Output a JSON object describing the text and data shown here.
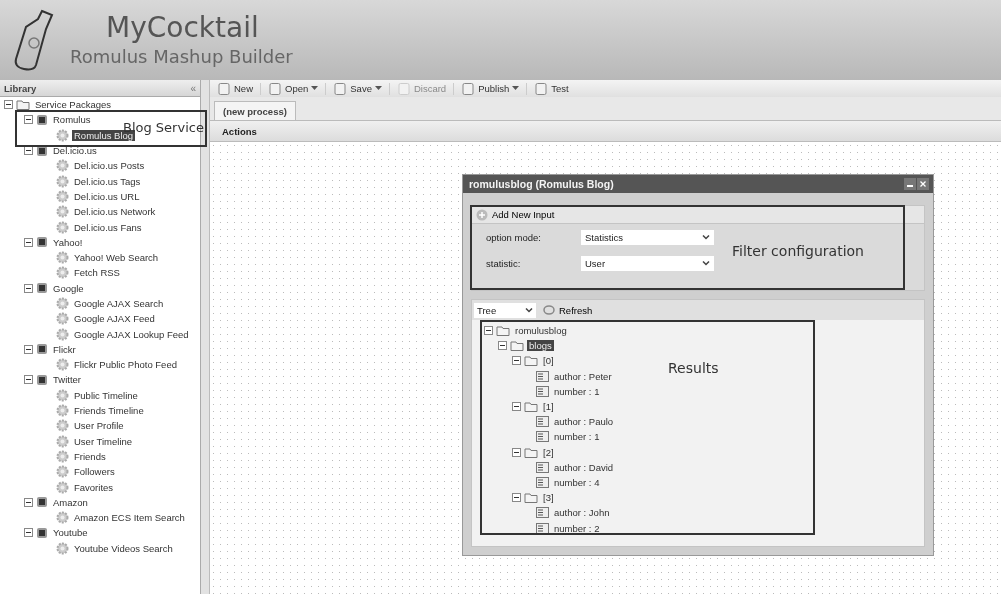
{
  "app": {
    "title": "MyCocktail",
    "subtitle": "Romulus Mashup Builder"
  },
  "library": {
    "title": "Library",
    "collapse": "«",
    "items": [
      {
        "label": "Service Packages",
        "expanded": true,
        "selected": false,
        "children": [
          {
            "label": "Romulus",
            "expanded": true,
            "selected": false,
            "children": [
              {
                "label": "Romulus Blog",
                "selected": true
              }
            ]
          },
          {
            "label": "Del.icio.us",
            "expanded": true,
            "selected": false,
            "children": [
              {
                "label": "Del.icio.us Posts",
                "selected": false
              },
              {
                "label": "Del.icio.us Tags",
                "selected": false
              },
              {
                "label": "Del.icio.us URL",
                "selected": false
              },
              {
                "label": "Del.icio.us Network",
                "selected": false
              },
              {
                "label": "Del.icio.us Fans",
                "selected": false
              }
            ]
          },
          {
            "label": "Yahoo!",
            "expanded": true,
            "selected": false,
            "children": [
              {
                "label": "Yahoo! Web Search",
                "selected": false
              },
              {
                "label": "Fetch RSS",
                "selected": false
              }
            ]
          },
          {
            "label": "Google",
            "expanded": true,
            "selected": false,
            "children": [
              {
                "label": "Google AJAX Search",
                "selected": false
              },
              {
                "label": "Google AJAX Feed",
                "selected": false
              },
              {
                "label": "Google AJAX Lookup Feed",
                "selected": false
              }
            ]
          },
          {
            "label": "Flickr",
            "expanded": true,
            "selected": false,
            "children": [
              {
                "label": "Flickr Public Photo Feed",
                "selected": false
              }
            ]
          },
          {
            "label": "Twitter",
            "expanded": true,
            "selected": false,
            "children": [
              {
                "label": "Public Timeline",
                "selected": false
              },
              {
                "label": "Friends Timeline",
                "selected": false
              },
              {
                "label": "User Profile",
                "selected": false
              },
              {
                "label": "User Timeline",
                "selected": false
              },
              {
                "label": "Friends",
                "selected": false
              },
              {
                "label": "Followers",
                "selected": false
              },
              {
                "label": "Favorites",
                "selected": false
              }
            ]
          },
          {
            "label": "Amazon",
            "expanded": true,
            "selected": false,
            "children": [
              {
                "label": "Amazon ECS Item Search",
                "selected": false
              }
            ]
          },
          {
            "label": "Youtube",
            "expanded": true,
            "selected": false,
            "children": [
              {
                "label": "Youtube Videos Search",
                "selected": false
              }
            ]
          }
        ]
      }
    ]
  },
  "toolbar": [
    {
      "label": "New",
      "menu": false,
      "disabled": false
    },
    {
      "label": "Open",
      "menu": true,
      "disabled": false
    },
    {
      "label": "Save",
      "menu": true,
      "disabled": false
    },
    {
      "label": "Discard",
      "menu": false,
      "disabled": true
    },
    {
      "label": "Publish",
      "menu": true,
      "disabled": false
    },
    {
      "label": "Test",
      "menu": false,
      "disabled": false
    }
  ],
  "tabs": [
    {
      "label": "(new process)",
      "selected": true
    }
  ],
  "actions_bar": "Actions",
  "dialog": {
    "title": "romulusblog (Romulus Blog)",
    "add_input": "Add New Input",
    "fields": [
      {
        "label": "option mode:",
        "value": "Statistics"
      },
      {
        "label": "statistic:",
        "value": "User"
      }
    ],
    "view": "Tree",
    "refresh": "Refresh",
    "tree": [
      {
        "label": "romulusblog",
        "expanded": true,
        "selected": false,
        "children": [
          {
            "label": "blogs",
            "expanded": true,
            "selected": true,
            "children": [
              {
                "label": "[0]",
                "expanded": true,
                "selected": false,
                "children": [
                  {
                    "label": "author : Peter",
                    "selected": false
                  },
                  {
                    "label": "number : 1",
                    "selected": false
                  }
                ]
              },
              {
                "label": "[1]",
                "expanded": true,
                "selected": false,
                "children": [
                  {
                    "label": "author : Paulo",
                    "selected": false
                  },
                  {
                    "label": "number : 1",
                    "selected": false
                  }
                ]
              },
              {
                "label": "[2]",
                "expanded": true,
                "selected": false,
                "children": [
                  {
                    "label": "author : David",
                    "selected": false
                  },
                  {
                    "label": "number : 4",
                    "selected": false
                  }
                ]
              },
              {
                "label": "[3]",
                "expanded": true,
                "selected": false,
                "children": [
                  {
                    "label": "author : John",
                    "selected": false
                  },
                  {
                    "label": "number : 2",
                    "selected": false
                  }
                ]
              }
            ]
          }
        ]
      }
    ]
  },
  "annotations": [
    {
      "text": "Blog Service"
    },
    {
      "text": "Filter configuration"
    },
    {
      "text": "Results"
    }
  ]
}
